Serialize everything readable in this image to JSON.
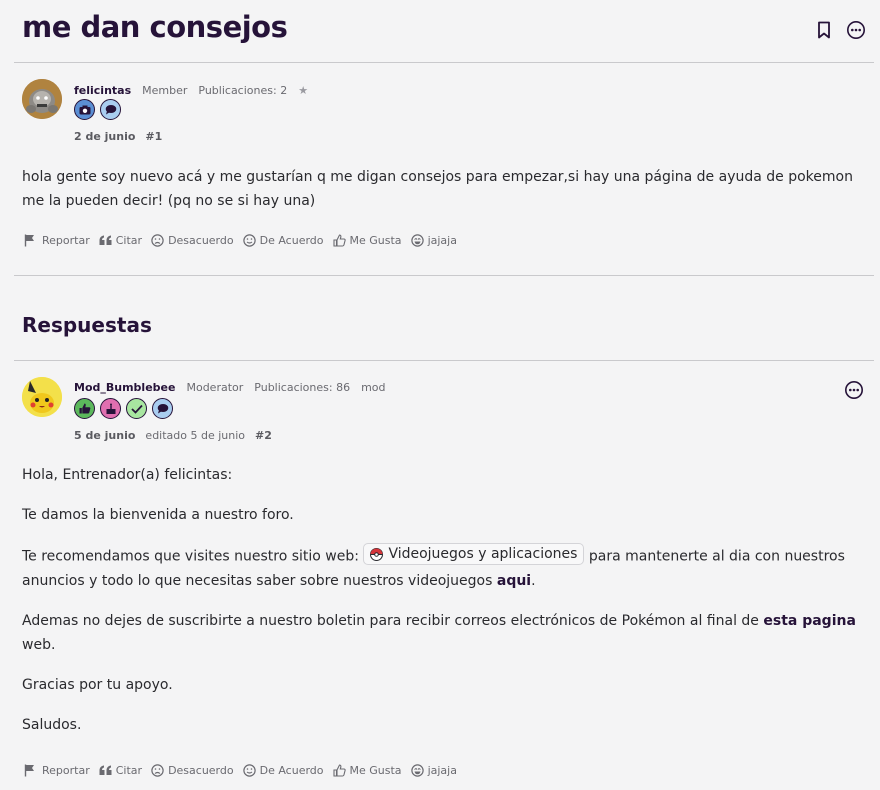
{
  "thread": {
    "title": "me dan consejos"
  },
  "header": {
    "bookmark_icon": "bookmark-icon",
    "more_icon": "more-options-icon"
  },
  "post1": {
    "username": "felicintas",
    "role": "Member",
    "posts_label": "Publicaciones: 2",
    "star": "★",
    "badges": [
      "camera-badge-icon",
      "chat-badge-icon"
    ],
    "date": "2 de junio",
    "number": "#1",
    "body": "hola gente soy nuevo acá y me gustarían q me digan consejos para empezar,si hay una página de ayuda de pokemon me la pueden decir! (pq no se si hay una)"
  },
  "actions": {
    "report": "Reportar",
    "quote": "Citar",
    "disagree": "Desacuerdo",
    "agree": "De Acuerdo",
    "like": "Me Gusta",
    "haha": "jajaja"
  },
  "replies": {
    "heading": "Respuestas"
  },
  "post2": {
    "username": "Mod_Bumblebee",
    "role": "Moderator",
    "posts_label": "Publicaciones: 86",
    "tag": "mod",
    "badges": [
      "thumbs-up-badge-icon",
      "cake-badge-icon",
      "check-badge-icon",
      "chat-badge-icon"
    ],
    "date": "5 de junio",
    "edited": "editado 5 de junio",
    "number": "#2",
    "p1": "Hola, Entrenador(a) felicintas:",
    "p2": "Te damos la bienvenida a nuestro foro.",
    "p3_a": "Te recomendamos que visites nuestro sitio web:",
    "p3_chip": "Videojuegos y aplicaciones",
    "p3_b": "para mantenerte al dia con nuestros anuncios y todo lo que necesitas saber sobre nuestros videojuegos",
    "p3_link": "aqui",
    "p3_end": ".",
    "p4_a": "Ademas no dejes de suscribirte a nuestro boletin para recibir correos electrónicos de Pokémon al final de",
    "p4_link": "esta pagina",
    "p4_b": "web.",
    "p5": "Gracias por tu apoyo.",
    "p6": "Saludos."
  },
  "colors": {
    "accent": "#261339",
    "divider": "#c9c9cc",
    "background": "#f4f4f5"
  }
}
